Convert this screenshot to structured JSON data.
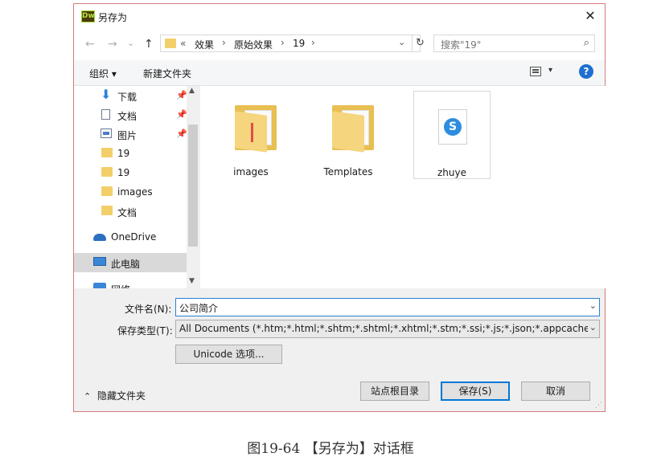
{
  "titlebar": {
    "title": "另存为",
    "app_icon": "Dw"
  },
  "nav": {
    "back": "←",
    "forward": "→",
    "down": "⌄",
    "up": "↑",
    "breadcrumbs": [
      "«",
      "效果",
      "原始效果",
      "19"
    ],
    "search_placeholder": "搜索\"19\""
  },
  "toolbar": {
    "organize": "组织 ▾",
    "new_folder": "新建文件夹",
    "help": "?"
  },
  "sidebar": {
    "items": [
      {
        "label": "下载",
        "pinned": true
      },
      {
        "label": "文档",
        "pinned": true
      },
      {
        "label": "图片",
        "pinned": true
      },
      {
        "label": "19"
      },
      {
        "label": "19"
      },
      {
        "label": "images"
      },
      {
        "label": "文档"
      },
      {
        "label": "OneDrive"
      },
      {
        "label": "此电脑",
        "selected": true
      },
      {
        "label": "网络"
      }
    ]
  },
  "files": [
    {
      "name": "images",
      "type": "folder"
    },
    {
      "name": "Templates",
      "type": "folder"
    },
    {
      "name": "zhuye",
      "type": "html"
    }
  ],
  "form": {
    "filename_label": "文件名(N):",
    "filename_value": "公司简介",
    "filetype_label": "保存类型(T):",
    "filetype_value": "All Documents (*.htm;*.html;*.shtm;*.shtml;*.xhtml;*.stm;*.ssi;*.js;*.json;*.appcache;*.xml;*.x",
    "unicode_button": "Unicode 选项..."
  },
  "footer": {
    "hide_folders": "隐藏文件夹",
    "site_root_button": "站点根目录",
    "save_button": "保存(S)",
    "cancel_button": "取消"
  },
  "caption": "图19-64 【另存为】对话框"
}
